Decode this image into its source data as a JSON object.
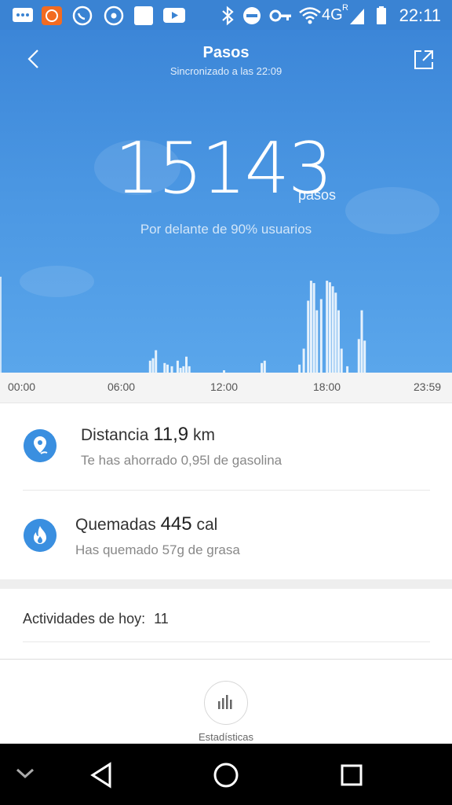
{
  "status_bar": {
    "time": "22:11",
    "network": "4G",
    "roaming": "R",
    "icons": [
      "message-icon",
      "mi-fit-icon",
      "whatsapp-icon",
      "record-icon",
      "blank-app-icon",
      "youtube-icon",
      "bluetooth-icon",
      "do-not-disturb-icon",
      "key-icon",
      "wifi-icon",
      "signal-icon",
      "battery-icon"
    ]
  },
  "header": {
    "title": "Pasos",
    "subtitle": "Sincronizado a las 22:09",
    "back_icon": "chevron-left-icon",
    "share_icon": "share-icon"
  },
  "summary": {
    "steps": "15143",
    "unit": "pasos",
    "rank": "Por delante de 90% usuarios"
  },
  "chart_data": {
    "type": "bar",
    "x_ticks": [
      "00:00",
      "06:00",
      "12:00",
      "18:00",
      "23:59"
    ],
    "bars": [
      {
        "t": "08:00",
        "v": 15
      },
      {
        "t": "08:10",
        "v": 18
      },
      {
        "t": "08:20",
        "v": 28
      },
      {
        "t": "08:50",
        "v": 12
      },
      {
        "t": "09:00",
        "v": 10
      },
      {
        "t": "09:15",
        "v": 8
      },
      {
        "t": "09:35",
        "v": 15
      },
      {
        "t": "09:45",
        "v": 6
      },
      {
        "t": "09:55",
        "v": 8
      },
      {
        "t": "10:05",
        "v": 20
      },
      {
        "t": "10:15",
        "v": 8
      },
      {
        "t": "12:15",
        "v": 3
      },
      {
        "t": "14:25",
        "v": 12
      },
      {
        "t": "14:35",
        "v": 15
      },
      {
        "t": "16:35",
        "v": 10
      },
      {
        "t": "16:50",
        "v": 30
      },
      {
        "t": "17:05",
        "v": 90
      },
      {
        "t": "17:15",
        "v": 115
      },
      {
        "t": "17:25",
        "v": 112
      },
      {
        "t": "17:35",
        "v": 78
      },
      {
        "t": "17:50",
        "v": 92
      },
      {
        "t": "18:10",
        "v": 115
      },
      {
        "t": "18:20",
        "v": 113
      },
      {
        "t": "18:30",
        "v": 108
      },
      {
        "t": "18:40",
        "v": 100
      },
      {
        "t": "18:50",
        "v": 78
      },
      {
        "t": "19:00",
        "v": 30
      },
      {
        "t": "19:20",
        "v": 8
      },
      {
        "t": "20:00",
        "v": 42
      },
      {
        "t": "20:10",
        "v": 78
      },
      {
        "t": "20:20",
        "v": 40
      }
    ],
    "y_max": 120
  },
  "distance": {
    "label": "Distancia",
    "value": "11,9",
    "unit": "km",
    "note": "Te has ahorrado 0,95l de gasolina",
    "icon": "location-pin-icon"
  },
  "calories": {
    "label": "Quemadas",
    "value": "445",
    "unit": "cal",
    "note": "Has quemado 57g de grasa",
    "icon": "flame-icon"
  },
  "activities": {
    "label": "Actividades de hoy:",
    "count": "11"
  },
  "stats": {
    "label": "Estadísticas",
    "icon": "bar-chart-icon"
  },
  "navbar": {
    "icons": [
      "chevron-down-icon",
      "back-triangle-icon",
      "home-circle-icon",
      "recents-square-icon"
    ]
  }
}
